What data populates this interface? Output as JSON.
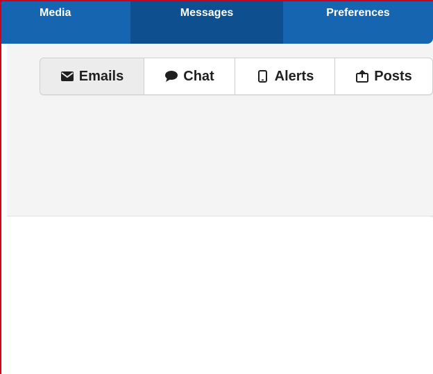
{
  "topnav": {
    "items": [
      {
        "label": "Media"
      },
      {
        "label": "Messages"
      },
      {
        "label": "Preferences"
      }
    ]
  },
  "tabs": [
    {
      "label": "Emails",
      "icon": "envelope-icon"
    },
    {
      "label": "Chat",
      "icon": "speech-bubble-icon"
    },
    {
      "label": "Alerts",
      "icon": "mobile-phone-icon"
    },
    {
      "label": "Posts",
      "icon": "share-post-icon"
    }
  ],
  "colors": {
    "nav_bg": "#1565b0",
    "nav_active": "#0d4f8f",
    "panel_bg": "#f4f4f4",
    "frame_border": "#d0021b"
  }
}
